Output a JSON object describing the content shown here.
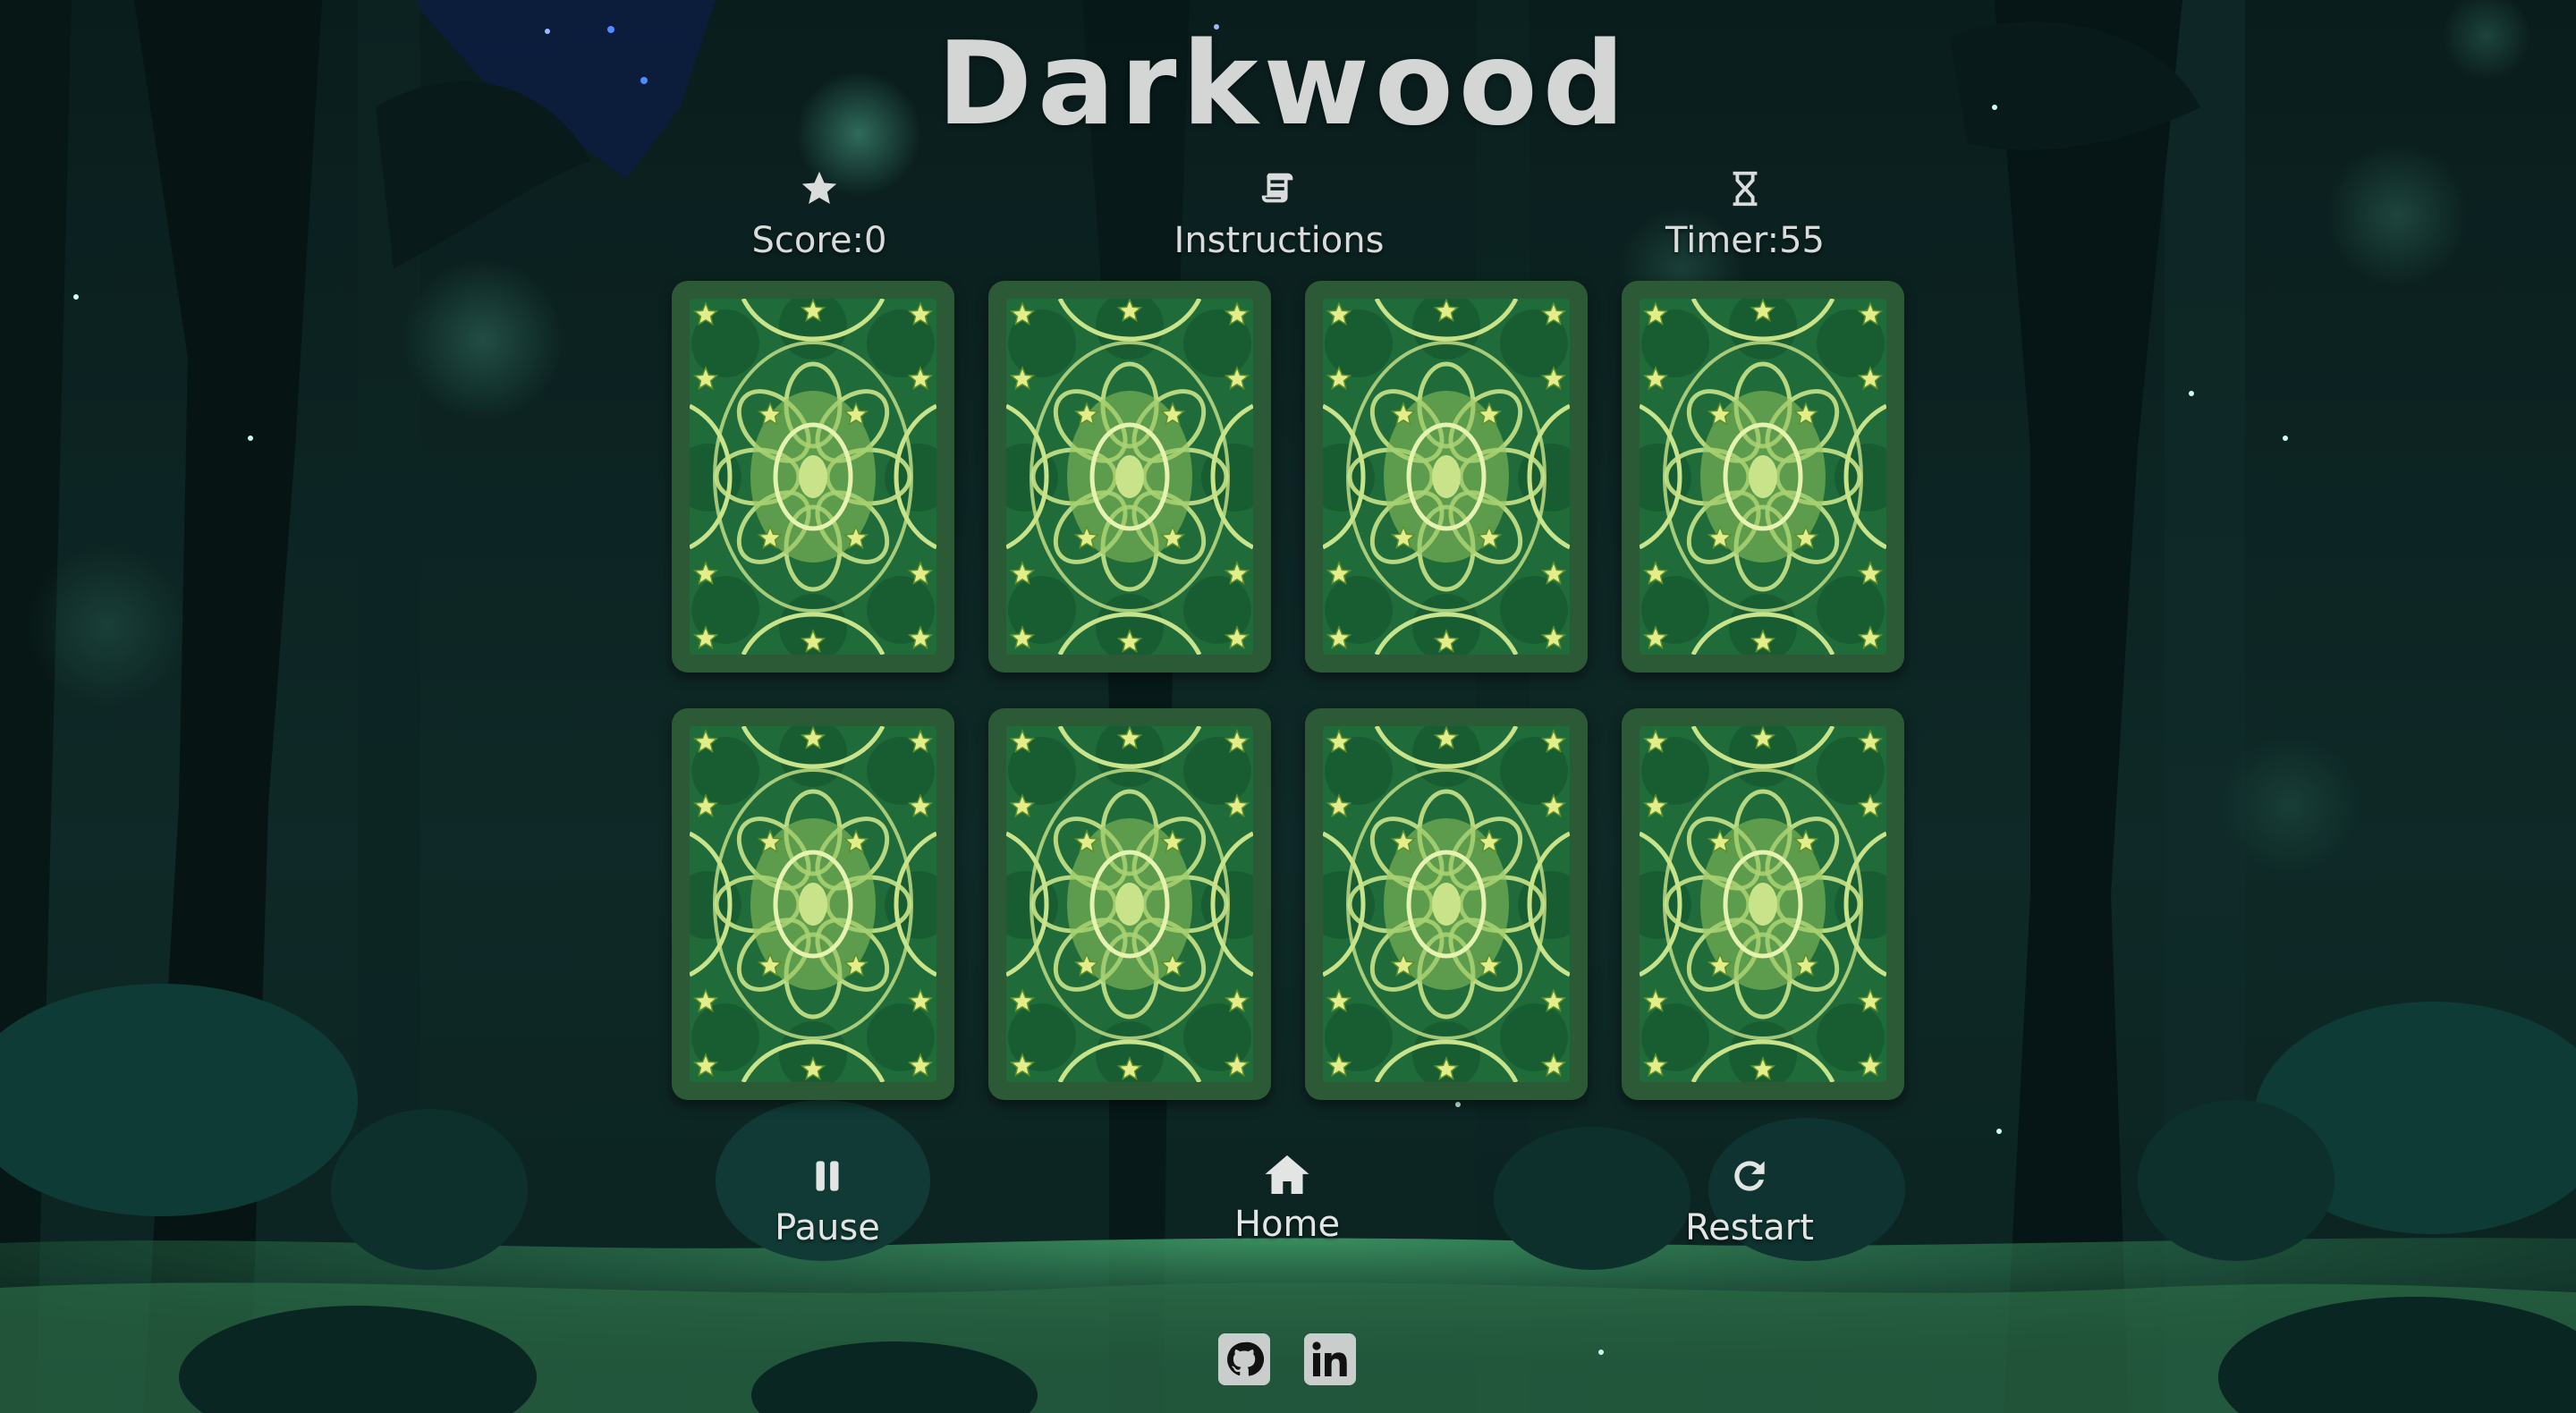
{
  "app": {
    "title": "Darkwood"
  },
  "stats": {
    "score": {
      "icon": "star-icon",
      "label": "Score:",
      "value": "0"
    },
    "instructions": {
      "icon": "scroll-icon",
      "label": "Instructions"
    },
    "timer": {
      "icon": "hourglass-icon",
      "label": "Timer:",
      "value": "55"
    }
  },
  "board": {
    "rows": 2,
    "columns": 4,
    "cards": [
      {
        "state": "face-down"
      },
      {
        "state": "face-down"
      },
      {
        "state": "face-down"
      },
      {
        "state": "face-down"
      },
      {
        "state": "face-down"
      },
      {
        "state": "face-down"
      },
      {
        "state": "face-down"
      },
      {
        "state": "face-down"
      }
    ]
  },
  "controls": {
    "pause": {
      "icon": "pause-icon",
      "label": "Pause"
    },
    "home": {
      "icon": "home-icon",
      "label": "Home"
    },
    "restart": {
      "icon": "restart-icon",
      "label": "Restart"
    }
  },
  "social": [
    {
      "icon": "github-icon"
    },
    {
      "icon": "linkedin-icon"
    }
  ],
  "colors": {
    "background": "#0b2220",
    "card_border": "#2d5a36",
    "card_pattern_dark": "#1f6b3a",
    "card_pattern_light": "#c8e38a",
    "text": "#d9dcdb"
  }
}
